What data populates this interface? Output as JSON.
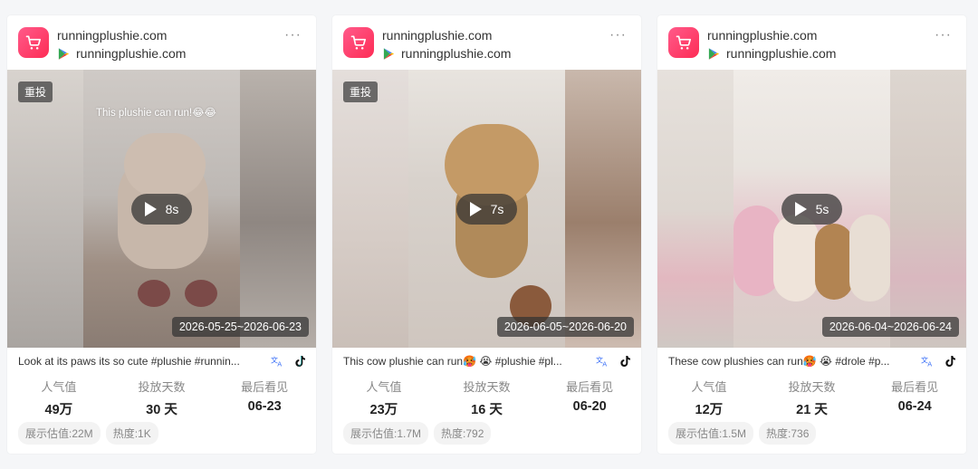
{
  "cards": [
    {
      "domain_primary": "runningplushie.com",
      "domain_secondary": "runningplushie.com",
      "more": "···",
      "badge": "重投",
      "overlay_text": "This plushie can run!😂😂",
      "duration": "8s",
      "date_range": "2026-05-25~2026-06-23",
      "description": "Look at its paws its so cute #plushie #runnin...",
      "stats": [
        {
          "label": "人气值",
          "value": "49万"
        },
        {
          "label": "投放天数",
          "value": "30 天"
        },
        {
          "label": "最后看见",
          "value": "06-23"
        }
      ],
      "tags": [
        "展示估值:22M",
        "热度:1K"
      ]
    },
    {
      "domain_primary": "runningplushie.com",
      "domain_secondary": "runningplushie.com",
      "more": "···",
      "badge": "重投",
      "overlay_text": "",
      "duration": "7s",
      "date_range": "2026-06-05~2026-06-20",
      "description": "This cow plushie can run🥵 😭 #plushie #pl...",
      "stats": [
        {
          "label": "人气值",
          "value": "23万"
        },
        {
          "label": "投放天数",
          "value": "16 天"
        },
        {
          "label": "最后看见",
          "value": "06-20"
        }
      ],
      "tags": [
        "展示估值:1.7M",
        "热度:792"
      ]
    },
    {
      "domain_primary": "runningplushie.com",
      "domain_secondary": "runningplushie.com",
      "more": "···",
      "badge": "",
      "overlay_text": "",
      "duration": "5s",
      "date_range": "2026-06-04~2026-06-24",
      "description": "These cow plushies can run🥵 😭 #drole #p...",
      "stats": [
        {
          "label": "人气值",
          "value": "12万"
        },
        {
          "label": "投放天数",
          "value": "21 天"
        },
        {
          "label": "最后看见",
          "value": "06-24"
        }
      ],
      "tags": [
        "展示估值:1.5M",
        "热度:736"
      ]
    }
  ],
  "icons": {
    "app_icon": "shopping-cart-icon",
    "store_icon": "google-play-icon",
    "translate_icon": "translate-icon",
    "platform_icon": "tiktok-icon",
    "play_icon": "play-icon"
  },
  "colors": {
    "app_icon": "#fe2c55",
    "background": "#f5f6f8"
  }
}
